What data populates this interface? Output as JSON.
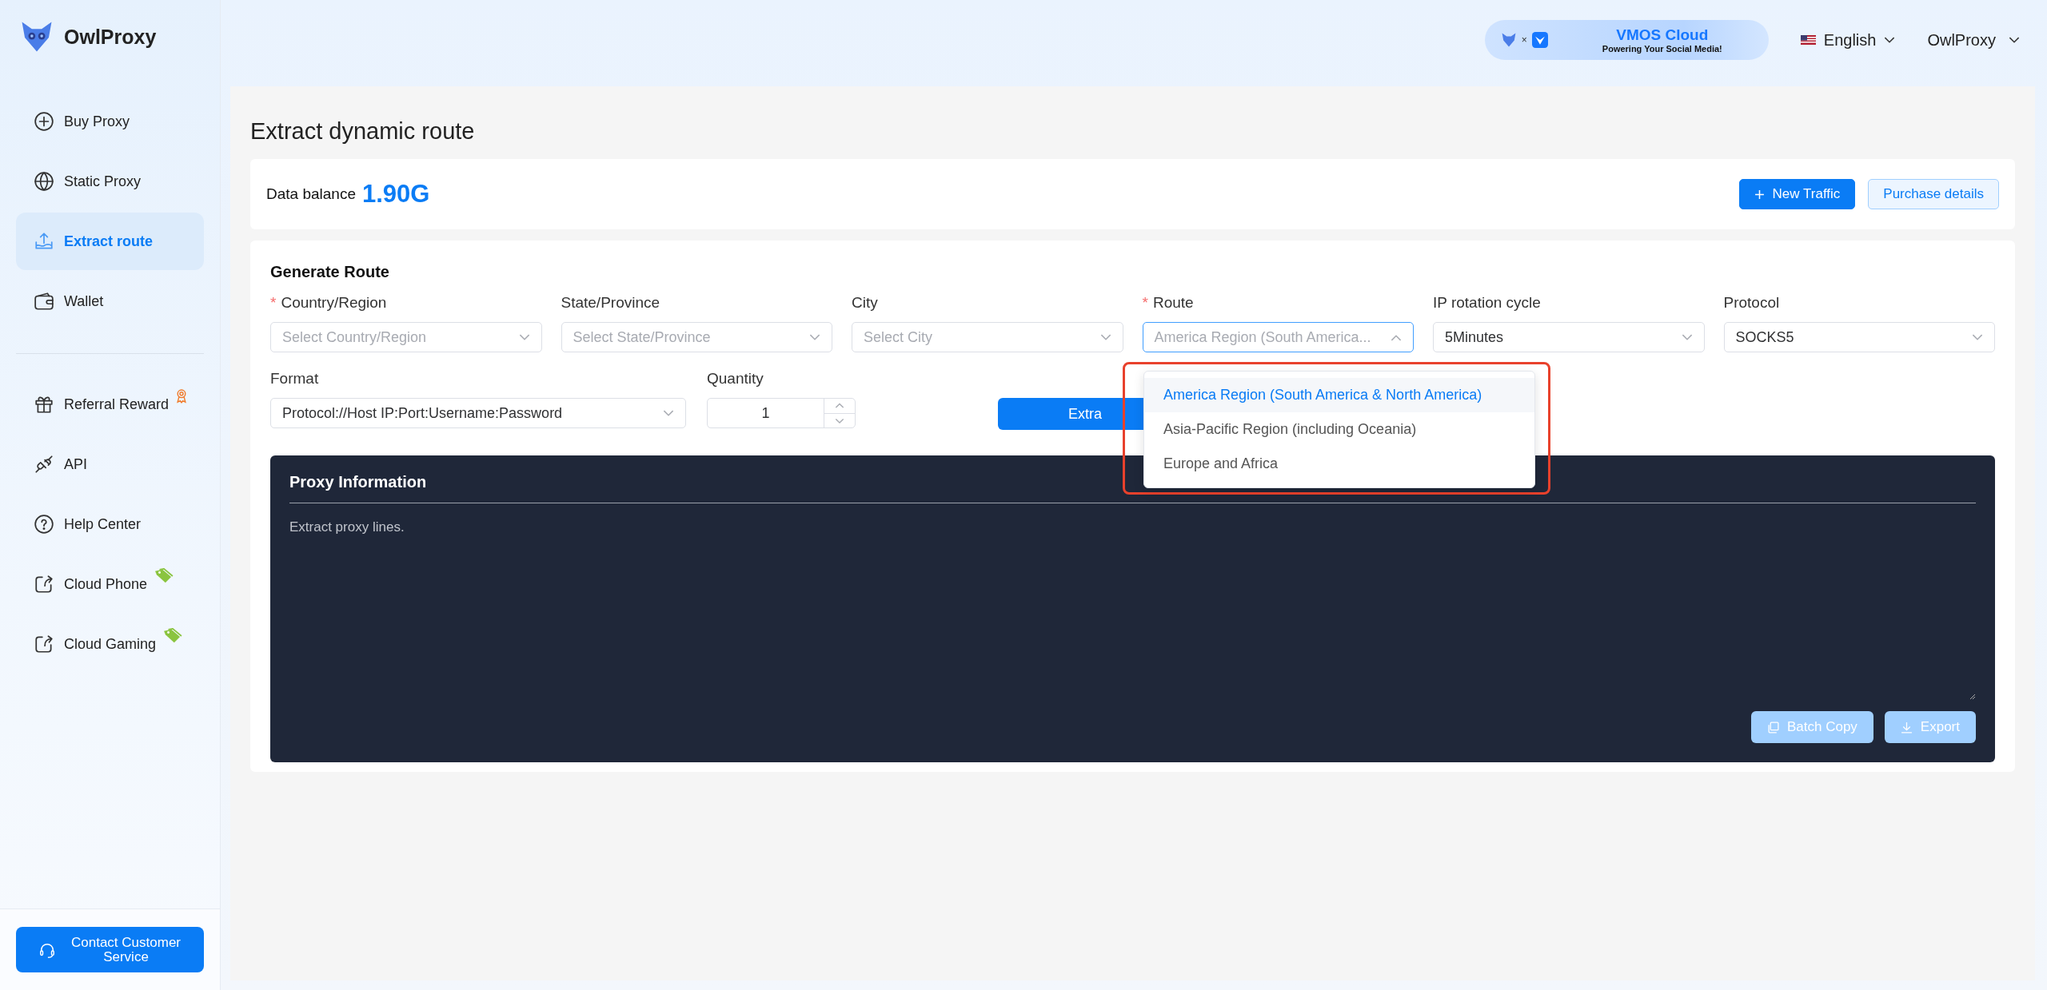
{
  "brand": {
    "name": "OwlProxy"
  },
  "sidebar": {
    "groups": [
      [
        {
          "label": "Buy Proxy",
          "selected": false
        },
        {
          "label": "Static Proxy",
          "selected": false
        },
        {
          "label": "Extract route",
          "selected": true
        },
        {
          "label": "Wallet",
          "selected": false
        }
      ],
      [
        {
          "label": "Referral Reward",
          "selected": false
        },
        {
          "label": "API",
          "selected": false
        },
        {
          "label": "Help Center",
          "selected": false
        },
        {
          "label": "Cloud Phone",
          "selected": false
        },
        {
          "label": "Cloud Gaming",
          "selected": false
        }
      ]
    ],
    "contact_button": "Contact Customer Service"
  },
  "header": {
    "banner": {
      "joiner": "×",
      "title": "VMOS Cloud",
      "subtitle": "Powering Your Social Media!"
    },
    "language": "English",
    "account": "OwlProxy"
  },
  "page_title": "Extract dynamic route",
  "balance": {
    "label": "Data balance",
    "value": "1.90G",
    "buttons": [
      {
        "label": "New Traffic",
        "kind": "primary"
      },
      {
        "label": "Purchase details",
        "kind": "secondary"
      }
    ]
  },
  "form": {
    "title": "Generate Route",
    "fields": [
      {
        "required_mark": "*",
        "label": "Country/Region",
        "placeholder": "Select Country/Region",
        "open": false
      },
      {
        "label": "State/Province",
        "placeholder": "Select State/Province",
        "open": false
      },
      {
        "label": "City",
        "placeholder": "Select City",
        "open": false
      },
      {
        "required_mark": "*",
        "label": "Route",
        "placeholder": "America Region (South America...",
        "open": true
      },
      {
        "label": "IP rotation cycle",
        "value": "5Minutes",
        "open": false
      },
      {
        "label": "Protocol",
        "value": "SOCKS5",
        "open": false
      }
    ],
    "format": {
      "label": "Format",
      "value": "Protocol://Host IP:Port:Username:Password"
    },
    "quantity": {
      "label": "Quantity",
      "value": "1"
    },
    "extract_button": "Extra",
    "dropdown": [
      {
        "label": "America Region (South America & North America)",
        "selected": true
      },
      {
        "label": "Asia-Pacific Region (including Oceania)",
        "selected": false
      },
      {
        "label": "Europe and Africa",
        "selected": false
      }
    ]
  },
  "proxy_info": {
    "title": "Proxy Information",
    "placeholder": "Extract proxy lines.",
    "buttons": [
      {
        "label": "Batch Copy",
        "disabled": true
      },
      {
        "label": "Export",
        "disabled": true
      }
    ]
  }
}
